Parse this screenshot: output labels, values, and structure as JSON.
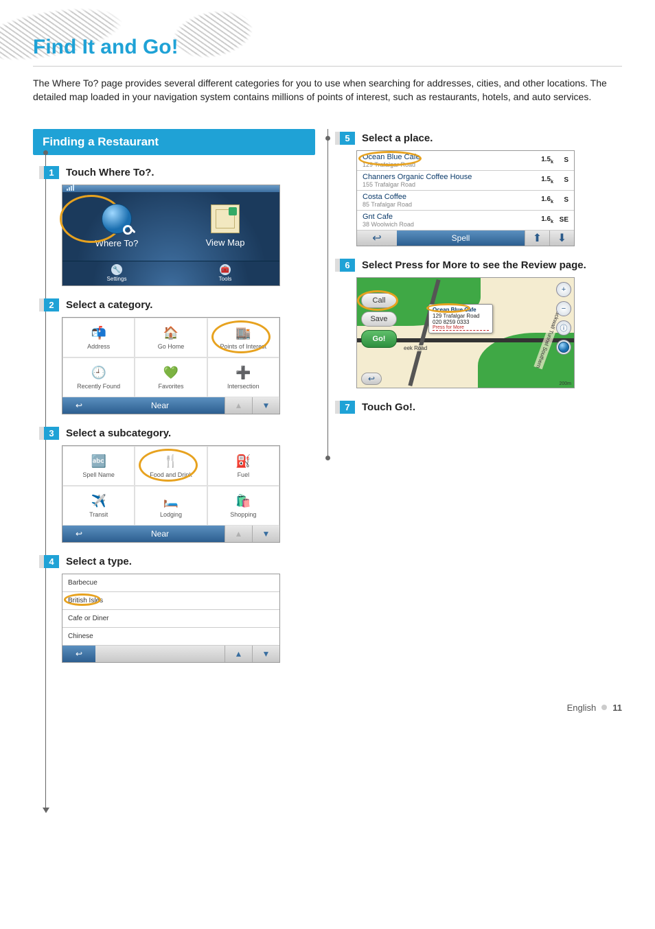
{
  "section_title": "Find It and Go!",
  "intro": "The Where To? page provides several different categories for you to use when searching for addresses, cities, and other locations. The detailed map loaded in your navigation system contains millions of points of interest, such as restaurants, hotels, and auto services.",
  "subsection_title": "Finding a Restaurant",
  "steps": {
    "s1": {
      "num": "1",
      "text": "Touch Where To?."
    },
    "s2": {
      "num": "2",
      "text": "Select a category."
    },
    "s3": {
      "num": "3",
      "text": "Select a subcategory."
    },
    "s4": {
      "num": "4",
      "text": "Select a type."
    },
    "s5": {
      "num": "5",
      "text": "Select a place."
    },
    "s6": {
      "num": "6",
      "text": " Select Press for More to see the Review page."
    },
    "s7": {
      "num": "7",
      "text": "Touch Go!."
    }
  },
  "shot1": {
    "where_to": "Where To?",
    "view_map": "View Map",
    "settings": "Settings",
    "tools": "Tools"
  },
  "shot2": {
    "items": [
      "Address",
      "Go Home",
      "Points of Interest",
      "Recently Found",
      "Favorites",
      "Intersection"
    ],
    "near": "Near"
  },
  "shot3": {
    "items": [
      "Spell Name",
      "Food and Drink",
      "Fuel",
      "Transit",
      "Lodging",
      "Shopping"
    ],
    "near": "Near"
  },
  "shot4": {
    "items": [
      "Barbecue",
      "British Isles",
      "Cafe or Diner",
      "Chinese"
    ]
  },
  "shot5": {
    "rows": [
      {
        "name": "Ocean Blue Cafe",
        "addr": "129 Trafalgar Road",
        "dist": "1.5",
        "unit": "k",
        "dir": "S"
      },
      {
        "name": "Channers Organic Coffee House",
        "addr": "155 Trafalgar Road",
        "dist": "1.5",
        "unit": "k",
        "dir": "S"
      },
      {
        "name": "Costa Coffee",
        "addr": "85 Trafalgar Road",
        "dist": "1.6",
        "unit": "k",
        "dir": "S"
      },
      {
        "name": "Gnt Cafe",
        "addr": "38 Woolwich Road",
        "dist": "1.6",
        "unit": "k",
        "dir": "SE"
      }
    ],
    "spell": "Spell"
  },
  "shot6": {
    "call": "Call",
    "save": "Save",
    "go": "Go!",
    "callout_title": "Ocean Blue Cafe",
    "callout_addr": "129 Trafalgar Road",
    "callout_phone": "020 8259 0333",
    "callout_more": "Press for More",
    "road_lbl1": "eek Road",
    "road_lbl2": "Blackwall Tunnel Southern",
    "scale": "200m"
  },
  "footer": {
    "lang": "English",
    "page": "11"
  }
}
